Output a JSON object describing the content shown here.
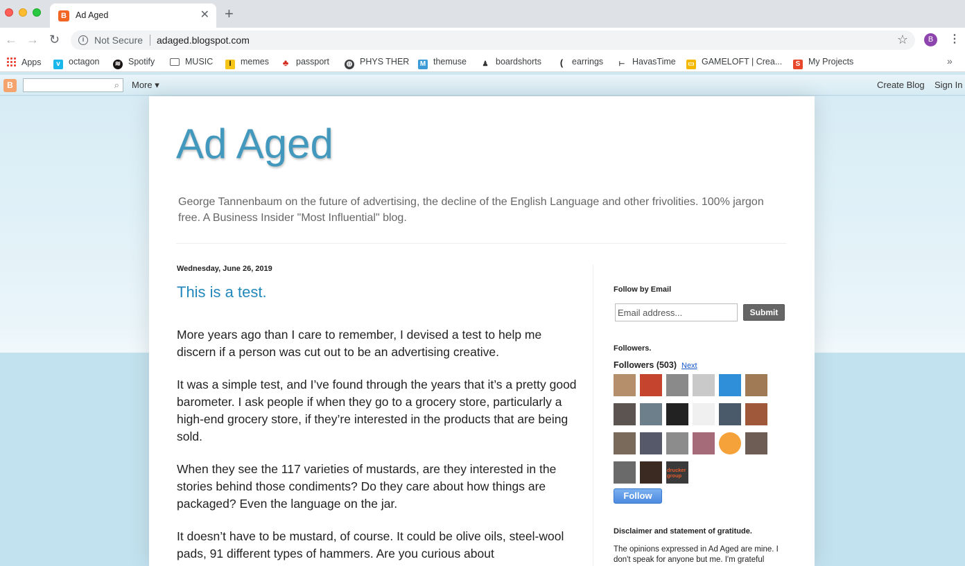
{
  "browser": {
    "tab_title": "Ad Aged",
    "tab_icon_letter": "B",
    "security_label": "Not Secure",
    "url": "adaged.blogspot.com",
    "profile_initial": "B",
    "bookmarks": [
      {
        "label": "Apps",
        "icon": "apps-grid-icon"
      },
      {
        "label": "octagon",
        "icon": "vimeo-icon"
      },
      {
        "label": "Spotify",
        "icon": "spotify-icon"
      },
      {
        "label": "MUSIC",
        "icon": "folder-icon"
      },
      {
        "label": "memes",
        "icon": "memes-icon"
      },
      {
        "label": "passport",
        "icon": "maple-leaf-icon"
      },
      {
        "label": "PHYS THER",
        "icon": "globe-icon"
      },
      {
        "label": "themuse",
        "icon": "themuse-icon"
      },
      {
        "label": "boardshorts",
        "icon": "boardshorts-icon"
      },
      {
        "label": "earrings",
        "icon": "earrings-icon"
      },
      {
        "label": "HavasTime",
        "icon": "havastime-icon"
      },
      {
        "label": "GAMELOFT | Crea...",
        "icon": "gameloft-icon"
      },
      {
        "label": "My Projects",
        "icon": "myprojects-icon"
      }
    ]
  },
  "blogger_nav": {
    "more_label": "More ▾",
    "create_blog": "Create Blog",
    "sign_in": "Sign In"
  },
  "blog": {
    "title": "Ad Aged",
    "description": "George Tannenbaum on the future of advertising, the decline of the English Language and other frivolities. 100% jargon free. A Business Insider \"Most Influential\" blog."
  },
  "post": {
    "date": "Wednesday, June 26, 2019",
    "title": "This is a test.",
    "paragraphs": [
      "More years ago than I care to remember, I devised a test to help me discern if a person was cut out to be an advertising creative.",
      "It was a simple test, and I’ve found through the years that it’s a pretty good barometer. I ask people if when they go to a grocery store, particularly a high-end grocery store, if they’re interested in the products that are being sold.",
      "When they see the 117 varieties of mustards, are they interested in the stories behind those condiments? Do they care about how things are packaged? Even the language on the jar.",
      "It doesn’t have to be mustard, of course. It could be olive oils, steel-wool pads, 91 different types of hammers. Are you curious about"
    ]
  },
  "sidebar": {
    "follow_email_heading": "Follow by Email",
    "email_placeholder": "Email address...",
    "submit_label": "Submit",
    "followers_heading": "Followers.",
    "followers_count": "Followers (503)",
    "next_label": "Next",
    "follow_label": "Follow",
    "drucker_label": "drucker group",
    "avatar_colors": [
      "#b58f6c",
      "#c4442e",
      "#8a8a8a",
      "#c9c9c9",
      "#2f8fd8",
      "#a07a55",
      "#5c5450",
      "#6d7f8a",
      "#222222",
      "#f0f0f0",
      "#4a5a6a",
      "#a0583a",
      "#7a6a5c",
      "#55596a",
      "#8c8c8c",
      "#a56b78",
      "#f5a23a",
      "#6d5d55",
      "#6a6a6a",
      "#3a2a22",
      "#3a3a3a"
    ],
    "disclaimer_heading": "Disclaimer and statement of gratitude.",
    "disclaimer_text": "The opinions expressed in Ad Aged are mine. I don't speak for anyone but me. I'm grateful"
  }
}
